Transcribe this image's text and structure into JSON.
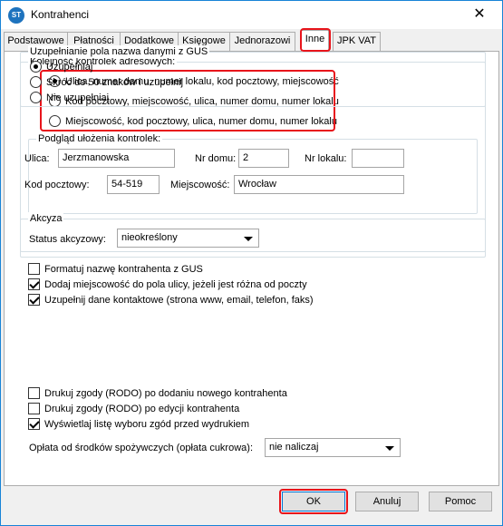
{
  "window": {
    "title": "Kontrahenci",
    "close_glyph": "✕",
    "icon_text": "ST"
  },
  "tabs": [
    {
      "label": "Podstawowe",
      "active": false
    },
    {
      "label": "Płatności",
      "active": false
    },
    {
      "label": "Dodatkowe",
      "active": false
    },
    {
      "label": "Księgowe",
      "active": false
    },
    {
      "label": "Jednorazowi",
      "active": false
    },
    {
      "label": "Inne",
      "active": true
    },
    {
      "label": "JPK VAT",
      "active": false
    }
  ],
  "address_order": {
    "legend": "Kolejność kontrolek adresowych:",
    "options": [
      {
        "label": "Ulica, numer domu, numer lokalu, kod pocztowy, miejscowość",
        "selected": true
      },
      {
        "label": "Kod pocztowy, miejscowość, ulica, numer domu, numer lokalu",
        "selected": false
      },
      {
        "label": "Miejscowość, kod pocztowy, ulica, numer domu, numer lokalu",
        "selected": false
      }
    ]
  },
  "preview": {
    "legend": "Podgląd ułożenia kontrolek:",
    "street_label": "Ulica:",
    "street_value": "Jerzmanowska",
    "house_label": "Nr domu:",
    "house_value": "2",
    "flat_label": "Nr lokalu:",
    "flat_value": "",
    "postal_label": "Kod pocztowy:",
    "postal_value": "54-519",
    "city_label": "Miejscowość:",
    "city_value": "Wrocław"
  },
  "excise": {
    "legend": "Akcyza",
    "status_label": "Status akcyzowy:",
    "status_value": "nieokreślony"
  },
  "checks1": [
    {
      "label": "Formatuj nazwę kontrahenta z GUS",
      "checked": false
    },
    {
      "label": "Dodaj miejscowość do pola ulicy, jeżeli jest różna od poczty",
      "checked": true
    },
    {
      "label": "Uzupełnij dane kontaktowe (strona www, email, telefon, faks)",
      "checked": true
    }
  ],
  "gus": {
    "legend": "Uzupełnianie pola nazwa danymi z GUS",
    "options": [
      {
        "label": "Uzupełniaj",
        "selected": true
      },
      {
        "label": "Skróć do 50 znaków i uzupełnij",
        "selected": false
      },
      {
        "label": "Nie uzupełniaj",
        "selected": false
      }
    ]
  },
  "checks2": [
    {
      "label": "Drukuj zgody (RODO) po dodaniu nowego kontrahenta",
      "checked": false
    },
    {
      "label": "Drukuj zgody (RODO) po edycji kontrahenta",
      "checked": false
    },
    {
      "label": "Wyświetlaj listę wyboru zgód przed wydrukiem",
      "checked": true
    }
  ],
  "sugar_fee": {
    "label": "Opłata od środków spożywczych (opłata cukrowa):",
    "value": "nie naliczaj"
  },
  "buttons": {
    "ok": "OK",
    "cancel": "Anuluj",
    "help": "Pomoc"
  },
  "highlight_color": "#e8141b"
}
